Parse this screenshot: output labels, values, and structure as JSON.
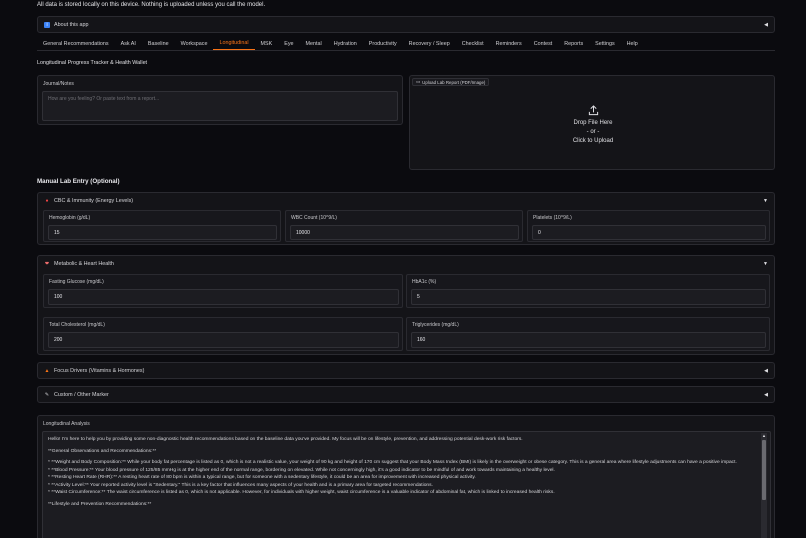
{
  "notice": "All data is stored locally on this device. Nothing is uploaded unless you call the model.",
  "about": {
    "label": "About this app",
    "icon": "info-icon"
  },
  "tabs": [
    "General Recommendations",
    "Ask AI",
    "Baseline",
    "Workspace",
    "Longitudinal",
    "MSK",
    "Eye",
    "Mental",
    "Hydration",
    "Productivity",
    "Recovery / Sleep",
    "Checklist",
    "Reminders",
    "Contest",
    "Reports",
    "Settings",
    "Help"
  ],
  "active_tab": "Longitudinal",
  "subtitle": "Longitudinal Progress Tracker & Health Wallet",
  "journal": {
    "label": "Journal/Notes",
    "placeholder": "How are you feeling? Or paste text from a report..."
  },
  "upload": {
    "label": "Upload Lab Report (PDF/Image)",
    "line1": "Drop File Here",
    "line2": "- or -",
    "line3": "Click to Upload"
  },
  "manual_title": "Manual Lab Entry (Optional)",
  "cbc": {
    "title": "CBC & Immunity (Energy Levels)",
    "fields": [
      {
        "label": "Hemoglobin (g/dL)",
        "value": "15"
      },
      {
        "label": "WBC Count (10^9/L)",
        "value": "10000"
      },
      {
        "label": "Platelets (10^9/L)",
        "value": "0"
      }
    ]
  },
  "metabolic": {
    "title": "Metabolic & Heart Health",
    "fields": [
      {
        "label": "Fasting Glucose (mg/dL)",
        "value": "100"
      },
      {
        "label": "HbA1c (%)",
        "value": "5"
      },
      {
        "label": "Total Cholesterol (mg/dL)",
        "value": "200"
      },
      {
        "label": "Triglycerides (mg/dL)",
        "value": "160"
      }
    ]
  },
  "focus": {
    "title": "Focus Drivers (Vitamins & Hormones)"
  },
  "custom": {
    "title": "Custom / Other Marker"
  },
  "analysis": {
    "label": "Longitudinal Analysis",
    "paragraphs": [
      "Hello! I'm here to help you by providing some non-diagnostic health recommendations based on the baseline data you've provided. My focus will be on lifestyle, prevention, and addressing potential desk-work risk factors.",
      "**General Observations and Recommendations:**",
      "*  **Weight and Body Composition:** While your body fat percentage is listed as 0, which is not a realistic value, your weight of 90 kg and height of 170 cm suggest that your Body Mass Index (BMI) is likely in the overweight or obese category. This is a general area where lifestyle adjustments can have a positive impact.",
      "*  **Blood Pressure:** Your blood pressure of 125/85 mmHg is at the higher end of the normal range, bordering on elevated. While not concerningly high, it's a good indicator to be mindful of and work towards maintaining a healthy level.",
      "*  **Resting Heart Rate (RHR):** A resting heart rate of 80 bpm is within a typical range, but for someone with a sedentary lifestyle, it could be an area for improvement with increased physical activity.",
      "*  **Activity Level:** Your reported activity level is \"Sedentary.\" This is a key factor that influences many aspects of your health and is a primary area for targeted recommendations.",
      "*  **Waist Circumference:** The waist circumference is listed as 0, which is not applicable. However, for individuals with higher weight, waist circumference is a valuable indicator of abdominal fat, which is linked to increased health risks.",
      "**Lifestyle and Prevention Recommendations:**"
    ]
  },
  "colors": {
    "accent": "#f97316",
    "background": "#0b0b0f",
    "panel": "#141418"
  }
}
